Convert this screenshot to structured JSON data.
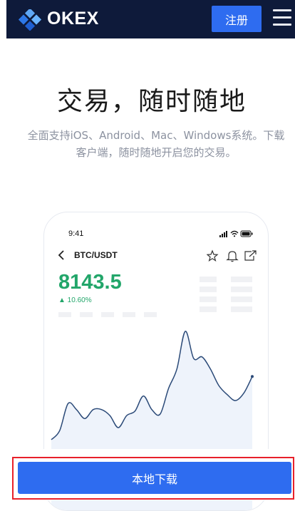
{
  "header": {
    "brand": "OKEX",
    "register_label": "注册",
    "menu_icon": "hamburger-menu-icon"
  },
  "hero": {
    "title": "交易，随时随地",
    "description": "全面支持iOS、Android、Mac、Windows系统。下载客户端，随时随地开启您的交易。"
  },
  "phone_preview": {
    "time": "9:41",
    "pair": "BTC/USDT",
    "price": "8143.5",
    "change": "▲ 10.60%",
    "icons": [
      "back-arrow-icon",
      "star-icon",
      "bell-icon",
      "share-icon"
    ]
  },
  "chart_data": {
    "type": "line",
    "title": "",
    "xlabel": "",
    "ylabel": "",
    "color": "#2b4a78",
    "x": [
      0,
      1,
      2,
      3,
      4,
      5,
      6,
      7,
      8,
      9,
      10,
      11,
      12,
      13,
      14,
      15,
      16,
      17,
      18,
      19,
      20,
      21,
      22,
      23,
      24
    ],
    "y": [
      1.0,
      1.6,
      3.4,
      3.0,
      2.4,
      3.0,
      3.0,
      2.6,
      1.8,
      2.6,
      2.9,
      3.9,
      3.0,
      2.7,
      4.4,
      5.7,
      8.2,
      6.4,
      6.5,
      5.7,
      4.6,
      4.0,
      3.6,
      4.1,
      5.2
    ],
    "ylim": [
      0,
      9
    ],
    "grid": false,
    "legend": false
  },
  "footer": {
    "download_label": "本地下载"
  },
  "colors": {
    "header_bg": "#0e1a3a",
    "accent": "#2e6cf0",
    "price_green": "#22a66a",
    "highlight_border": "#e8202a"
  }
}
